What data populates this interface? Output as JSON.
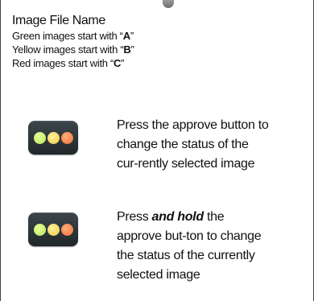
{
  "header": {
    "title": "Image File Name",
    "rules": [
      {
        "prefix": "Green images start with “",
        "letter": "A",
        "suffix": "”"
      },
      {
        "prefix": "Yellow images start with “",
        "letter": "B",
        "suffix": "”"
      },
      {
        "prefix": "Red images start with “",
        "letter": "C",
        "suffix": "”"
      }
    ]
  },
  "rows": [
    {
      "icon": "traffic-light-icon",
      "text": "Press the approve button to change the status of the cur-rently selected image"
    },
    {
      "icon": "traffic-light-icon",
      "text_before": "Press ",
      "text_emphasis": "and hold",
      "text_after": " the approve but-ton to change the status of the currently selected image"
    }
  ],
  "colors": {
    "green": "#b7e65a",
    "yellow": "#f1c94a",
    "red": "#ef6a32",
    "button_bg": "#2d3538"
  }
}
